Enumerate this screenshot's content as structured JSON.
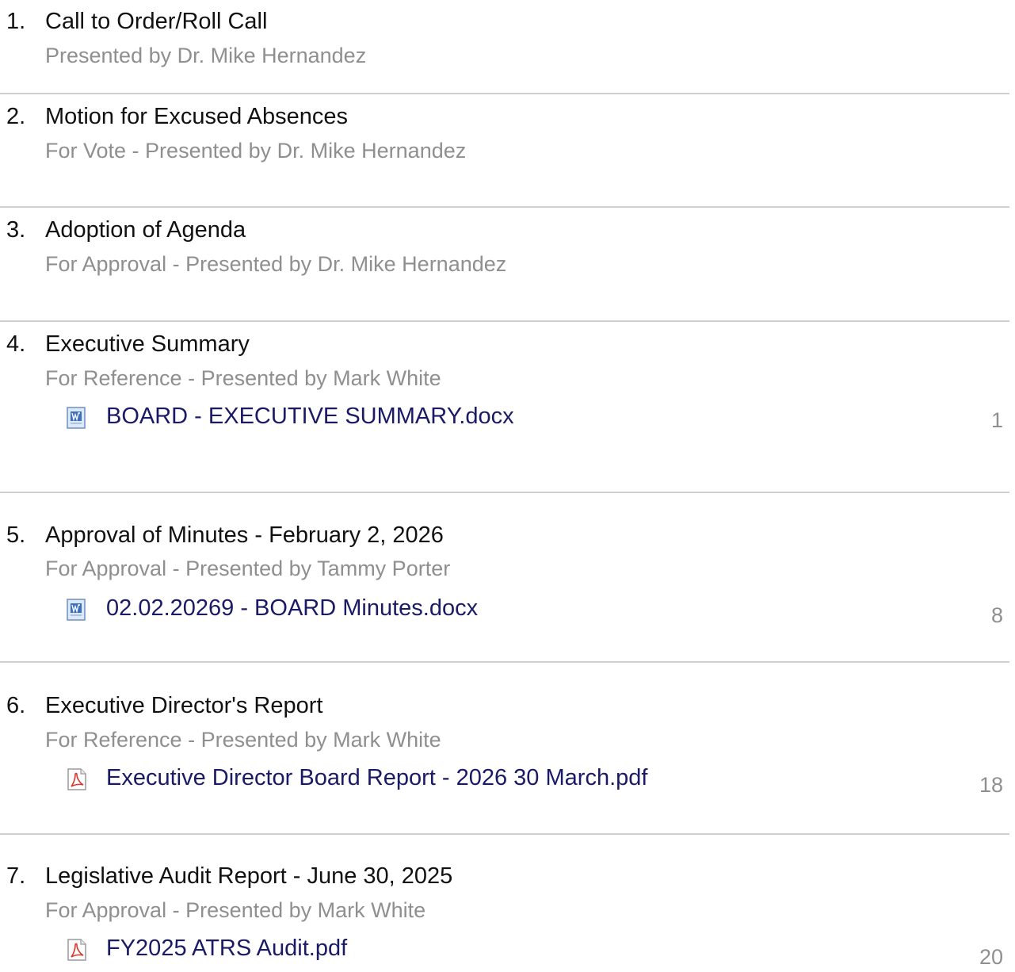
{
  "agenda": {
    "items": [
      {
        "number": "1.",
        "title": "Call to Order/Roll Call",
        "subtitle": "Presented by Dr. Mike Hernandez"
      },
      {
        "number": "2.",
        "title": "Motion for Excused Absences",
        "subtitle": "For Vote - Presented by Dr. Mike Hernandez"
      },
      {
        "number": "3.",
        "title": "Adoption of Agenda",
        "subtitle": "For Approval - Presented by Dr. Mike Hernandez"
      },
      {
        "number": "4.",
        "title": "Executive Summary",
        "subtitle": "For Reference - Presented by Mark White",
        "attachment": {
          "icon": "word-document-icon",
          "name": "BOARD - EXECUTIVE SUMMARY.docx",
          "page": "1"
        }
      },
      {
        "number": "5.",
        "title": "Approval of Minutes - February 2, 2026",
        "subtitle": "For Approval - Presented by Tammy Porter",
        "attachment": {
          "icon": "word-document-icon",
          "name": "02.02.20269 - BOARD Minutes.docx",
          "page": "8"
        }
      },
      {
        "number": "6.",
        "title": "Executive Director's Report",
        "subtitle": "For Reference - Presented by Mark White",
        "attachment": {
          "icon": "pdf-document-icon",
          "name": "Executive Director Board Report - 2026 30 March.pdf",
          "page": "18"
        }
      },
      {
        "number": "7.",
        "title": "Legislative Audit Report - June 30, 2025",
        "subtitle": "For Approval - Presented by Mark White",
        "attachment": {
          "icon": "pdf-document-icon",
          "name": "FY2025 ATRS Audit.pdf",
          "page": "20"
        }
      }
    ]
  },
  "colors": {
    "title": "#111111",
    "subtitle": "#8f8f8f",
    "link": "#1a1a66",
    "divider": "#d0d0d0"
  }
}
